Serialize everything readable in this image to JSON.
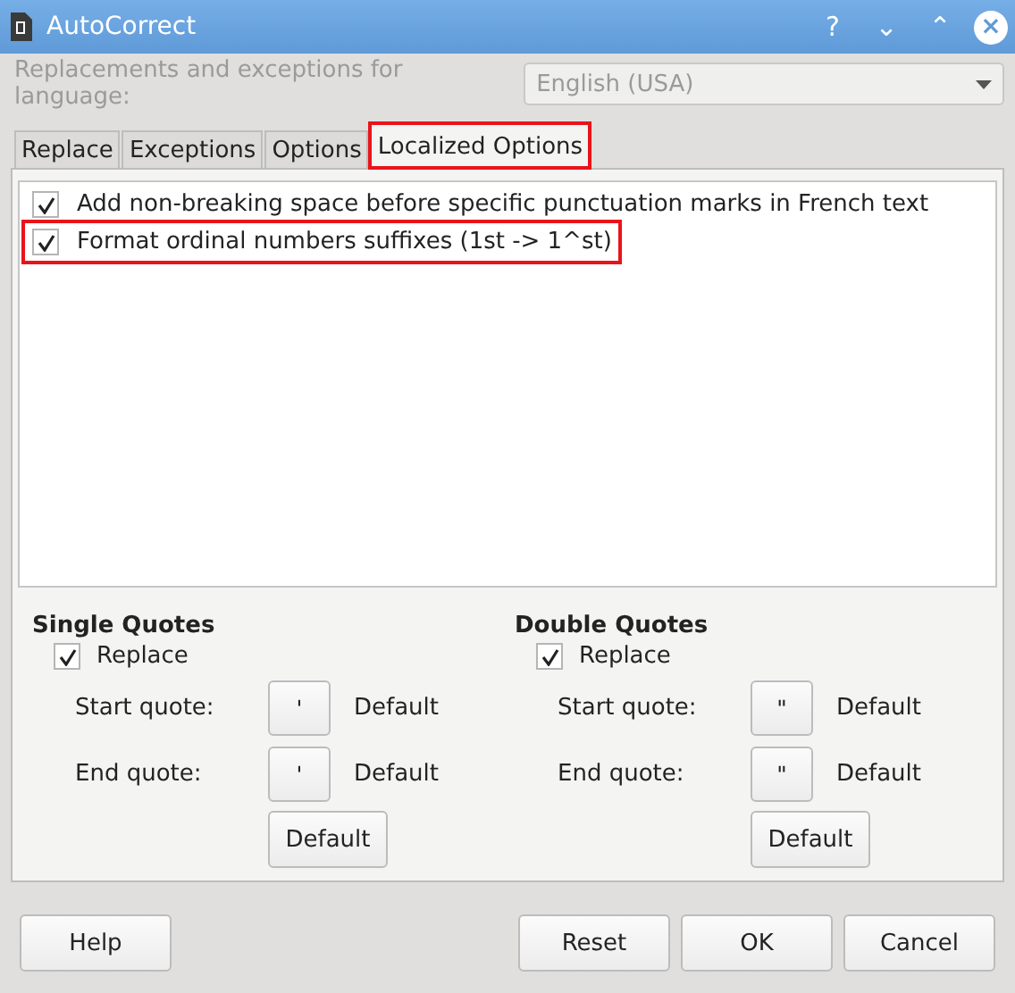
{
  "window": {
    "title": "AutoCorrect",
    "controls": [
      "?",
      "⌄",
      "⌃",
      "×"
    ]
  },
  "language": {
    "label": "Replacements and exceptions for language:",
    "value": "English (USA)",
    "disabled": true
  },
  "tabs": [
    {
      "label": "Replace",
      "selected": false,
      "highlighted": false
    },
    {
      "label": "Exceptions",
      "selected": false,
      "highlighted": false
    },
    {
      "label": "Options",
      "selected": false,
      "highlighted": false
    },
    {
      "label": "Localized Options",
      "selected": true,
      "highlighted": true
    }
  ],
  "options": [
    {
      "label": "Add non-breaking space before specific punctuation marks in French text",
      "checked": true,
      "highlighted": false
    },
    {
      "label": "Format ordinal numbers suffixes (1st -> 1^st)",
      "checked": true,
      "highlighted": true
    }
  ],
  "quote_groups": [
    {
      "title": "Single Quotes",
      "replace": {
        "label": "Replace",
        "checked": true
      },
      "rows": [
        {
          "label": "Start quote:",
          "char": "'",
          "value": "Default"
        },
        {
          "label": "End quote:",
          "char": "'",
          "value": "Default"
        }
      ],
      "default_button": "Default"
    },
    {
      "title": "Double Quotes",
      "replace": {
        "label": "Replace",
        "checked": true
      },
      "rows": [
        {
          "label": "Start quote:",
          "char": "\"",
          "value": "Default"
        },
        {
          "label": "End quote:",
          "char": "\"",
          "value": "Default"
        }
      ],
      "default_button": "Default"
    }
  ],
  "buttons": {
    "left": [
      "Help"
    ],
    "right": [
      "Reset",
      "OK",
      "Cancel"
    ]
  }
}
